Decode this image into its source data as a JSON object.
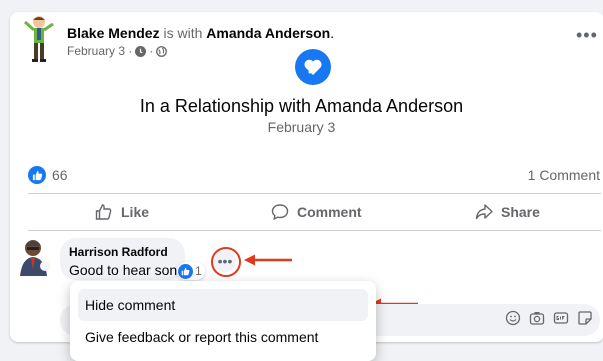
{
  "post": {
    "author_name": "Blake Mendez",
    "with_text": " is with ",
    "tagged_name": "Amanda Anderson",
    "tail": ".",
    "date": "February 3 ·",
    "sep": "·",
    "event_title": "In a Relationship with Amanda Anderson",
    "event_date": "February 3",
    "reaction_count": "66",
    "comment_count": "1 Comment"
  },
  "actions": {
    "like": "Like",
    "comment": "Comment",
    "share": "Share"
  },
  "comment": {
    "author": "Harrison Radford",
    "text": "Good to hear son",
    "reaction_count": "1"
  },
  "menu": {
    "items": [
      "Hide comment",
      "Give feedback or report this comment"
    ]
  },
  "icons": [
    "clock-icon",
    "globe-icon",
    "heart-icon",
    "like-icon",
    "comment-icon",
    "share-icon",
    "emoji-icon",
    "camera-icon",
    "gif-icon",
    "sticker-icon",
    "more-icon"
  ],
  "colors": {
    "accent": "#1877f2",
    "annotation": "#e0391d"
  }
}
